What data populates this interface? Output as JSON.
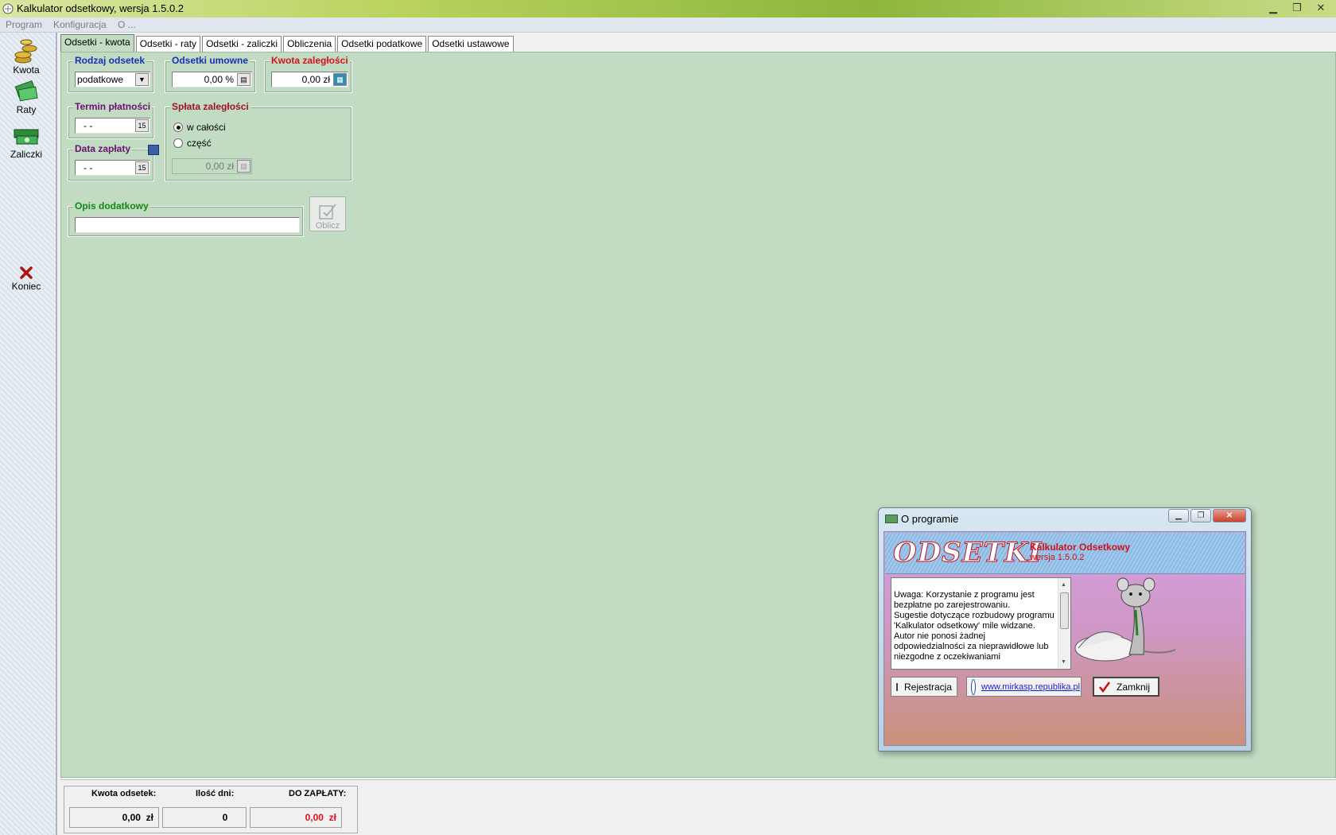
{
  "window": {
    "title": "Kalkulator odsetkowy, wersja 1.5.0.2"
  },
  "menu": [
    "Program",
    "Konfiguracja",
    "O ..."
  ],
  "sidebar": {
    "items": [
      {
        "label": "Kwota"
      },
      {
        "label": "Raty"
      },
      {
        "label": "Zaliczki"
      },
      {
        "label": "Koniec"
      }
    ]
  },
  "tabs": [
    "Odsetki - kwota",
    "Odsetki - raty",
    "Odsetki - zaliczki",
    "Obliczenia",
    "Odsetki podatkowe",
    "Odsetki ustawowe"
  ],
  "form": {
    "rodzaj": {
      "label": "Rodzaj odsetek",
      "value": "podatkowe"
    },
    "umowne": {
      "label": "Odsetki umowne",
      "value": "0,00 %"
    },
    "kwota": {
      "label": "Kwota zaległości",
      "value": "0,00 zł"
    },
    "termin": {
      "label": "Termin płatności",
      "value": "-  -"
    },
    "data_zaplaty": {
      "label": "Data zapłaty",
      "value": "-  -"
    },
    "splata": {
      "label": "Spłata zaległości",
      "opt1": "w całości",
      "opt2": "część",
      "value": "0,00 zł"
    },
    "opis": {
      "label": "Opis dodatkowy",
      "value": ""
    },
    "calc_button": "Oblicz",
    "cal_icon_text": "15"
  },
  "status": {
    "kwota_odsetek_label": "Kwota odsetek:",
    "kwota_odsetek_value": "0,00",
    "ilosc_dni_label": "Ilość dni:",
    "ilosc_dni_value": "0",
    "do_zaplaty_label": "DO ZAPŁATY:",
    "do_zaplaty_value": "0,00",
    "currency": "zł"
  },
  "dialog": {
    "title": "O programie",
    "logo": "ODSETKI",
    "product": "Kalkulator Odsetkowy",
    "version": "wersja  1.5.0.2",
    "text": "Uwaga: Korzystanie z programu jest bezpłatne po zarejestrowaniu.\nSugestie dotyczące rozbudowy programu 'Kalkulator odsetkowy' mile widzane.\nAutor nie ponosi żadnej odpowiedzialności za nieprawidłowe lub niezgodne z oczekiwaniami",
    "register_button": "Rejestracja",
    "link": "www.mirkasp.republika.pl",
    "close_button": "Zamknij"
  },
  "colors": {
    "panel_bg": "#c1dcc3",
    "label_blue": "#1a2fb8",
    "label_red": "#d4141c",
    "amount_red": "#e0101a"
  }
}
